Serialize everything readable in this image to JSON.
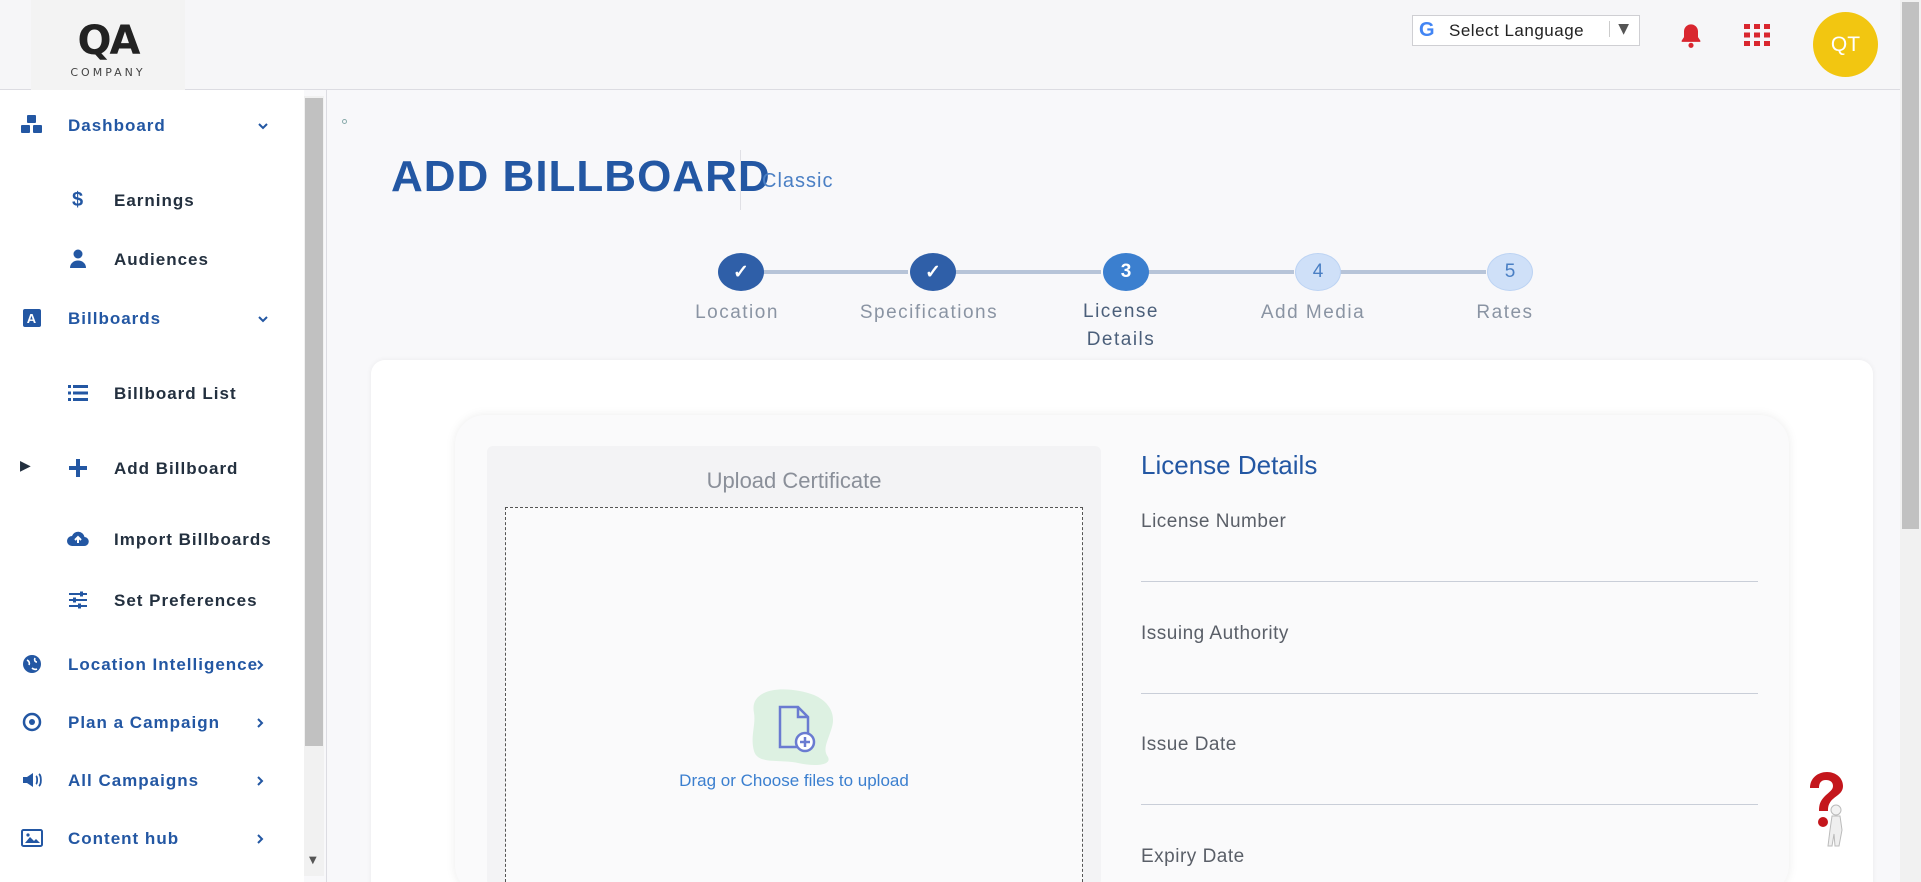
{
  "header": {
    "logo_text": "QA",
    "logo_sub": "COMPANY",
    "language_label": "Select Language",
    "avatar_initials": "QT"
  },
  "sidebar": {
    "items": [
      {
        "label": "Dashboard",
        "icon": "cubes-icon"
      },
      {
        "label": "Earnings",
        "icon": "dollar-icon"
      },
      {
        "label": "Audiences",
        "icon": "user-icon"
      },
      {
        "label": "Billboards",
        "icon": "billboard-icon"
      },
      {
        "label": "Billboard List",
        "icon": "list-icon"
      },
      {
        "label": "Add Billboard",
        "icon": "plus-icon"
      },
      {
        "label": "Import Billboards",
        "icon": "cloud-upload-icon"
      },
      {
        "label": "Set Preferences",
        "icon": "sliders-icon"
      },
      {
        "label": "Location Intelligence",
        "icon": "globe-icon"
      },
      {
        "label": "Plan a Campaign",
        "icon": "target-icon"
      },
      {
        "label": "All Campaigns",
        "icon": "megaphone-icon"
      },
      {
        "label": "Content hub",
        "icon": "image-icon"
      }
    ]
  },
  "page": {
    "title": "ADD BILLBOARD",
    "subtitle": "Classic"
  },
  "stepper": {
    "steps": [
      {
        "label": "Location",
        "marker": "✓",
        "state": "done"
      },
      {
        "label": "Specifications",
        "marker": "✓",
        "state": "done"
      },
      {
        "label_line1": "License",
        "label_line2": "Details",
        "marker": "3",
        "state": "active"
      },
      {
        "label": "Add Media",
        "marker": "4",
        "state": "todo"
      },
      {
        "label": "Rates",
        "marker": "5",
        "state": "todo"
      }
    ]
  },
  "upload": {
    "title": "Upload Certificate",
    "instructions": "Drag or Choose files to upload"
  },
  "license_form": {
    "title": "License Details",
    "license_number_label": "License Number",
    "issuing_authority_label": "Issuing Authority",
    "issue_date_label": "Issue Date",
    "expiry_date_label": "Expiry Date"
  },
  "colors": {
    "brand_blue": "#2357a3",
    "accent_blue": "#3b7fcf",
    "avatar_yellow": "#f2c611",
    "bell_red": "#d9262f"
  }
}
